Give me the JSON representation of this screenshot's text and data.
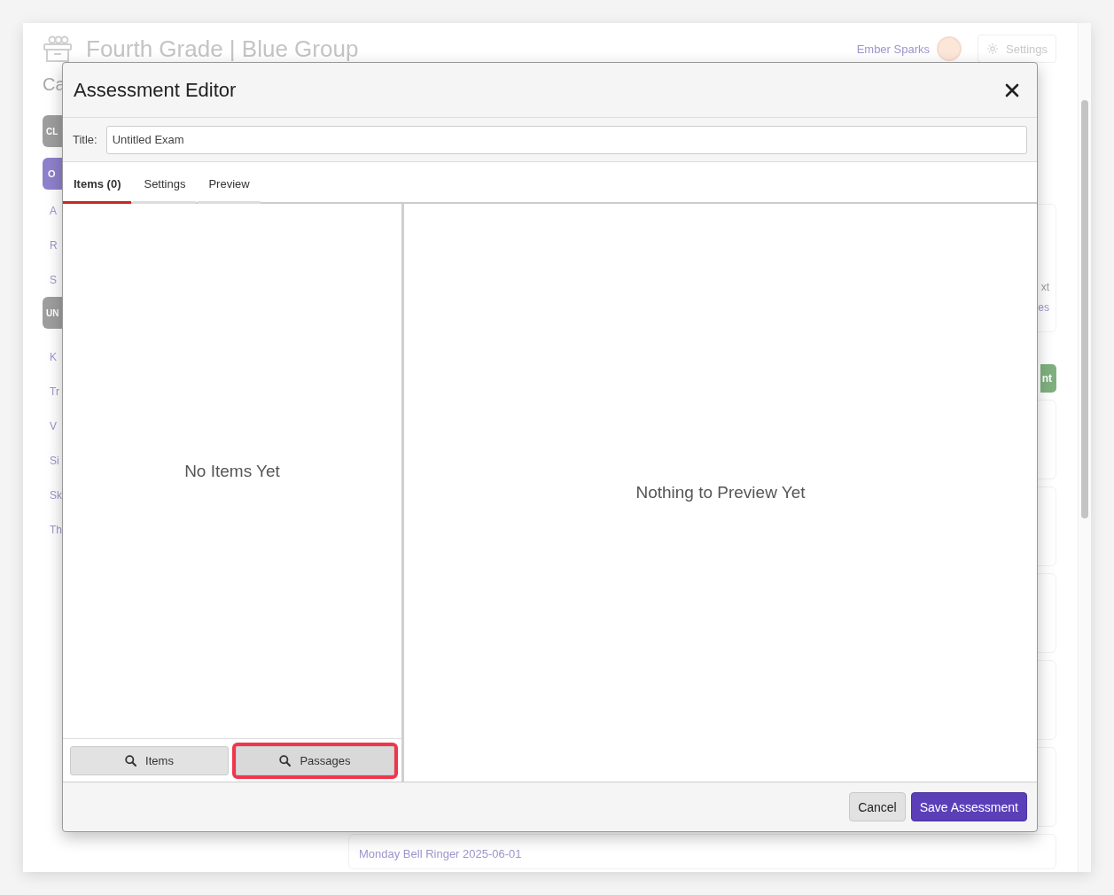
{
  "background_page": {
    "title": "Fourth Grade | Blue Group",
    "subtitle": "Ca",
    "user_name": "Ember Sparks",
    "settings_button": "Settings",
    "sidebar": [
      {
        "kind": "group",
        "label": "CL"
      },
      {
        "kind": "active",
        "label": "O"
      },
      {
        "kind": "link",
        "label": "A"
      },
      {
        "kind": "link",
        "label": "R"
      },
      {
        "kind": "link",
        "label": "S"
      },
      {
        "kind": "group",
        "label": "UN"
      },
      {
        "kind": "link",
        "label": "K"
      },
      {
        "kind": "link",
        "label": "Tr"
      },
      {
        "kind": "link",
        "label": "V"
      },
      {
        "kind": "link",
        "label": "Si"
      },
      {
        "kind": "link",
        "label": "Sk"
      },
      {
        "kind": "link",
        "label": "Th"
      }
    ],
    "card_fragments": [
      "xt",
      "es"
    ],
    "green_button": "nt",
    "last_card_title": "Monday Bell Ringer 2025-06-01"
  },
  "modal": {
    "title": "Assessment Editor",
    "title_label": "Title:",
    "title_value": "Untitled Exam",
    "tabs": [
      {
        "label": "Items (0)",
        "selected": true
      },
      {
        "label": "Settings",
        "selected": false
      },
      {
        "label": "Preview",
        "selected": false
      }
    ],
    "items_pane": {
      "empty_text": "No Items Yet",
      "buttons": [
        {
          "label": "Items",
          "highlighted": false
        },
        {
          "label": "Passages",
          "highlighted": true
        }
      ]
    },
    "preview_pane": {
      "empty_text": "Nothing to Preview Yet"
    },
    "footer_buttons": [
      {
        "label": "Cancel",
        "kind": "secondary"
      },
      {
        "label": "Save Assessment",
        "kind": "primary"
      }
    ]
  }
}
